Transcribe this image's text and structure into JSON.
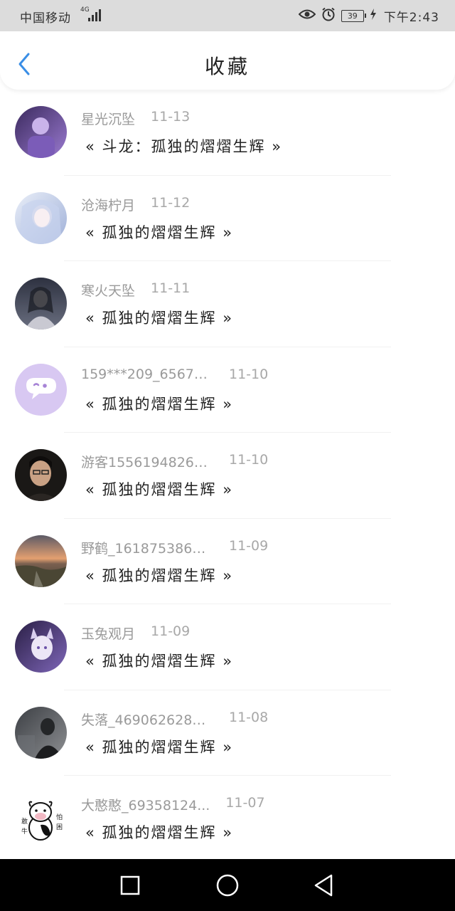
{
  "status_bar": {
    "carrier": "中国移动",
    "network": "4G",
    "battery": "39",
    "time": "下午2:43"
  },
  "header": {
    "title": "收藏"
  },
  "items": [
    {
      "name": "星光沉坠",
      "date": "11-13",
      "title": "« 斗龙：孤独的熠熠生辉 »"
    },
    {
      "name": "沧海柠月",
      "date": "11-12",
      "title": "« 孤独的熠熠生辉 »"
    },
    {
      "name": "寒火天坠",
      "date": "11-11",
      "title": "« 孤独的熠熠生辉 »"
    },
    {
      "name": "159***209_656749...",
      "date": "11-10",
      "title": "« 孤独的熠熠生辉 »"
    },
    {
      "name": "游客15561948263...",
      "date": "11-10",
      "title": "« 孤独的熠熠生辉 »"
    },
    {
      "name": "野鹤_1618753863...",
      "date": "11-09",
      "title": "« 孤独的熠熠生辉 »"
    },
    {
      "name": "玉兔观月",
      "date": "11-09",
      "title": "« 孤独的熠熠生辉 »"
    },
    {
      "name": "失落_4690626282...",
      "date": "11-08",
      "title": "« 孤独的熠熠生辉 »"
    },
    {
      "name": "大憨憨_69358124...",
      "date": "11-07",
      "title": "« 孤独的熠熠生辉 »"
    }
  ],
  "avatar_badge_text": [
    "敢",
    "牛",
    "怕",
    "困"
  ],
  "colors": {
    "accent": "#3a8ee6",
    "status_bar_bg": "#dcdcdc",
    "nav_bar_bg": "#000000",
    "meta_text": "#9a9a9a"
  }
}
